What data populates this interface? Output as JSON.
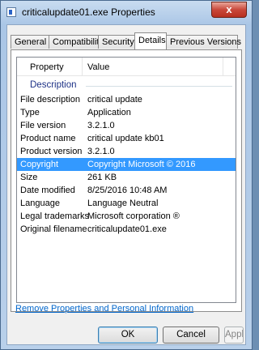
{
  "window": {
    "title": "criticalupdate01.exe Properties",
    "close_glyph": "x"
  },
  "tabs": [
    {
      "label": "General"
    },
    {
      "label": "Compatibility"
    },
    {
      "label": "Security"
    },
    {
      "label": "Details",
      "active": true
    },
    {
      "label": "Previous Versions"
    }
  ],
  "details": {
    "header": {
      "property": "Property",
      "value": "Value"
    },
    "group": "Description",
    "rows": [
      {
        "property": "File description",
        "value": "critical update"
      },
      {
        "property": "Type",
        "value": "Application"
      },
      {
        "property": "File version",
        "value": "3.2.1.0"
      },
      {
        "property": "Product name",
        "value": "critical update kb01"
      },
      {
        "property": "Product version",
        "value": "3.2.1.0"
      },
      {
        "property": "Copyright",
        "value": "Copyright Microsoft © 2016",
        "selected": true
      },
      {
        "property": "Size",
        "value": "261 KB"
      },
      {
        "property": "Date modified",
        "value": "8/25/2016 10:48 AM"
      },
      {
        "property": "Language",
        "value": "Language Neutral"
      },
      {
        "property": "Legal trademarks",
        "value": "Microsoft corporation ®"
      },
      {
        "property": "Original filename",
        "value": "criticalupdate01.exe"
      }
    ]
  },
  "link": "Remove Properties and Personal Information",
  "buttons": {
    "ok": "OK",
    "cancel": "Cancel",
    "apply": "Apply"
  }
}
